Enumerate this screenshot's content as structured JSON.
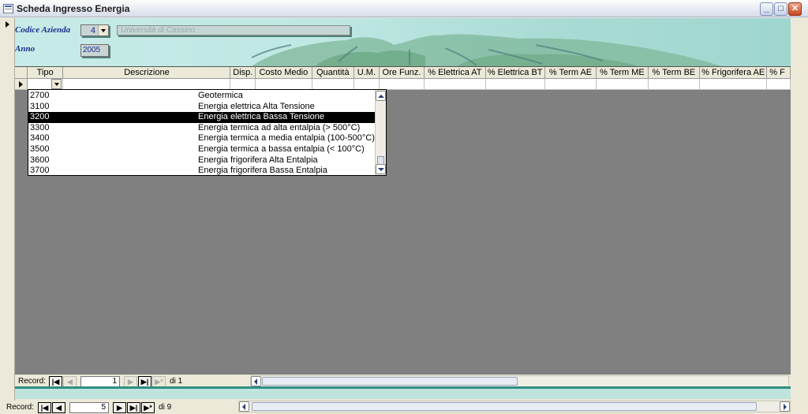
{
  "window": {
    "title": "Scheda Ingresso Energia",
    "buttons": {
      "minimize": "_",
      "maximize": "□",
      "close": "✕"
    }
  },
  "header": {
    "codice_label": "Codice Azienda",
    "codice_value": "4",
    "azienda_name": "Università di Cassino",
    "anno_label": "Anno",
    "anno_value": "2005"
  },
  "grid": {
    "columns": [
      "Tipo",
      "Descrizione",
      "Disp.",
      "Costo Medio",
      "Quantità",
      "U.M.",
      "Ore Funz.",
      "% Elettrica AT",
      "% Elettrica BT",
      "% Term AE",
      "% Term ME",
      "% Term BE",
      "% Frigorifera AE",
      "% F"
    ]
  },
  "dropdown": {
    "items": [
      {
        "code": "2700",
        "desc": "Geotermica"
      },
      {
        "code": "3100",
        "desc": "Energia elettrica Alta Tensione"
      },
      {
        "code": "3200",
        "desc": "Energia elettrica Bassa Tensione",
        "selected": true
      },
      {
        "code": "3300",
        "desc": "Energia termica ad alta entalpia (> 500°C)"
      },
      {
        "code": "3400",
        "desc": "Energia termica a media entalpia (100-500°C)"
      },
      {
        "code": "3500",
        "desc": "Energia termica a bassa entalpia (< 100°C)"
      },
      {
        "code": "3600",
        "desc": "Energia frigorifera Alta Entalpia"
      },
      {
        "code": "3700",
        "desc": "Energia frigorifera Bassa Entalpia"
      }
    ]
  },
  "subform_nav": {
    "label": "Record:",
    "current": "1",
    "total": "di 1"
  },
  "main_nav": {
    "label": "Record:",
    "current": "5",
    "total": "di 9"
  },
  "nav_glyphs": {
    "first": "|◀",
    "prev": "◀",
    "next": "▶",
    "last": "▶|",
    "new": "▶*"
  }
}
